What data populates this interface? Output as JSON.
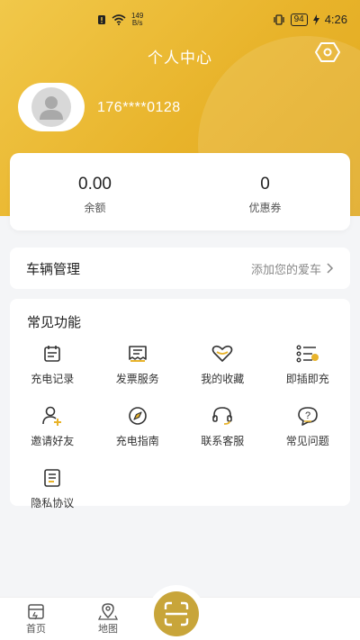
{
  "status_bar": {
    "net_speed": "149",
    "net_unit": "B/s",
    "battery": "94",
    "time": "4:26"
  },
  "header": {
    "title": "个人中心"
  },
  "profile": {
    "phone": "176****0128"
  },
  "wallet": {
    "balance_value": "0.00",
    "balance_label": "余额",
    "coupon_value": "0",
    "coupon_label": "优惠券"
  },
  "vehicle": {
    "title": "车辆管理",
    "add_label": "添加您的爱车"
  },
  "functions": {
    "title": "常见功能",
    "items": [
      {
        "label": "充电记录",
        "icon": "calendar-icon"
      },
      {
        "label": "发票服务",
        "icon": "invoice-icon"
      },
      {
        "label": "我的收藏",
        "icon": "heart-icon"
      },
      {
        "label": "即插即充",
        "icon": "list-icon"
      },
      {
        "label": "邀请好友",
        "icon": "add-user-icon"
      },
      {
        "label": "充电指南",
        "icon": "compass-icon"
      },
      {
        "label": "联系客服",
        "icon": "headset-icon"
      },
      {
        "label": "常见问题",
        "icon": "question-icon"
      },
      {
        "label": "隐私协议",
        "icon": "document-icon"
      }
    ]
  },
  "tabbar": {
    "home": "首页",
    "map": "地图"
  },
  "colors": {
    "accent": "#e8b32a",
    "background": "#f4f5f7"
  }
}
